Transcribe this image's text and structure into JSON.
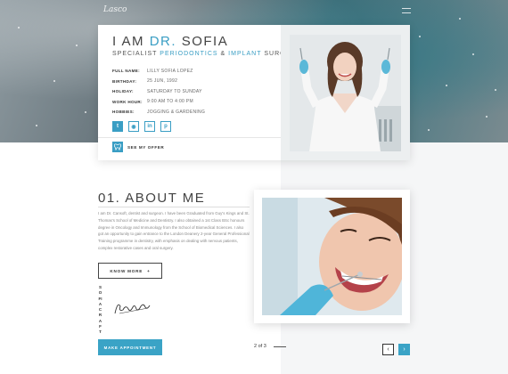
{
  "hero": {
    "logo": "Lasco"
  },
  "profile": {
    "title_prefix": "I AM",
    "title_accent": "DR.",
    "title_name": "SOFIA",
    "subtitle_pre": "SPECIALIST",
    "subtitle_accent1": "PERIODONTICS",
    "subtitle_amp": "&",
    "subtitle_accent2": "IMPLANT",
    "subtitle_post": "SURGEON",
    "info": [
      {
        "label": "FULL NAME:",
        "value": "LILLY SOFIA LOPEZ"
      },
      {
        "label": "BIRTHDAY:",
        "value": "25 JUN, 1992"
      },
      {
        "label": "HOLIDAY:",
        "value": "SATURDAY TO SUNDAY"
      },
      {
        "label": "WORK HOUR:",
        "value": "9:00 AM TO 4:00 PM"
      },
      {
        "label": "HOBBIES:",
        "value": "JOGGING & GARDENING"
      }
    ],
    "socials": [
      {
        "name": "twitter",
        "glyph": "t"
      },
      {
        "name": "github",
        "glyph": "◉"
      },
      {
        "name": "linkedin",
        "glyph": "in"
      },
      {
        "name": "pinterest",
        "glyph": "p"
      }
    ],
    "offer_label": "SEE MY OFFER"
  },
  "about": {
    "title": "01. ABOUT ME",
    "text": "I am Dr. Cansoft, dentist and surgeon. I have been Graduated from Guy's Kings and St. Thomas's School of Medicine and Dentistry. I also obtained a 1st Class BSc honours degree in Oncology and Immunology from the School of Biomedical Sciences. I also got an opportunity to gain entrance to the London Deanery 2-year General Professional Training programme in dentistry, with emphasis on dealing with nervous patients, complex restorative cases and oral surgery.",
    "know_more": "KNOW MORE",
    "know_more_icon": "+",
    "vertical_name": "SOFIACRAFT",
    "signature": "Lasco",
    "appointment": "MAKE APPOINTMENT"
  },
  "pager": {
    "label": "2 of 3"
  },
  "nav": {
    "prev": "‹",
    "next": "›"
  },
  "colors": {
    "accent": "#3a9ec4"
  }
}
